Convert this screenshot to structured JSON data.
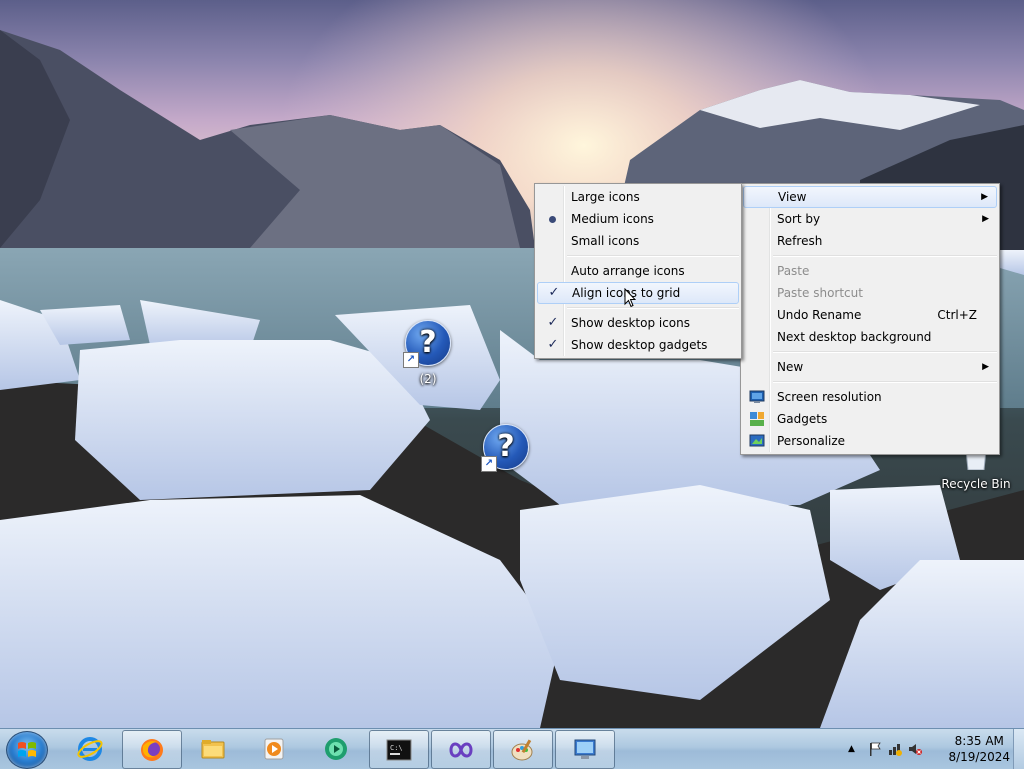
{
  "desktop": {
    "icons": [
      {
        "label": "(2)"
      },
      {
        "label": ""
      },
      {
        "label": "Recycle Bin"
      }
    ]
  },
  "view_submenu": {
    "items": [
      {
        "label": "Large icons"
      },
      {
        "label": "Medium icons",
        "selected": true
      },
      {
        "label": "Small icons"
      },
      {
        "label": "Auto arrange icons"
      },
      {
        "label": "Align icons to grid",
        "checked": true
      },
      {
        "label": "Show desktop icons",
        "checked": true
      },
      {
        "label": "Show desktop gadgets",
        "checked": true
      }
    ]
  },
  "context_menu": {
    "view": "View",
    "sort_by": "Sort by",
    "refresh": "Refresh",
    "paste": "Paste",
    "paste_shortcut": "Paste shortcut",
    "undo_rename": "Undo Rename",
    "undo_shortcut": "Ctrl+Z",
    "next_background": "Next desktop background",
    "new": "New",
    "screen_resolution": "Screen resolution",
    "gadgets": "Gadgets",
    "personalize": "Personalize"
  },
  "taskbar": {
    "apps": [
      "internet-explorer-icon",
      "firefox-icon",
      "file-explorer-icon",
      "media-player-icon",
      "media-center-icon",
      "command-prompt-icon",
      "visual-studio-icon",
      "paint-icon",
      "remote-desktop-icon"
    ],
    "clock_time": "8:35 AM",
    "clock_date": "8/19/2024"
  },
  "colors": {
    "taskbar": "#adc8e0",
    "menu_bg": "#f0f0f0",
    "highlight_border": "#aecff7"
  }
}
